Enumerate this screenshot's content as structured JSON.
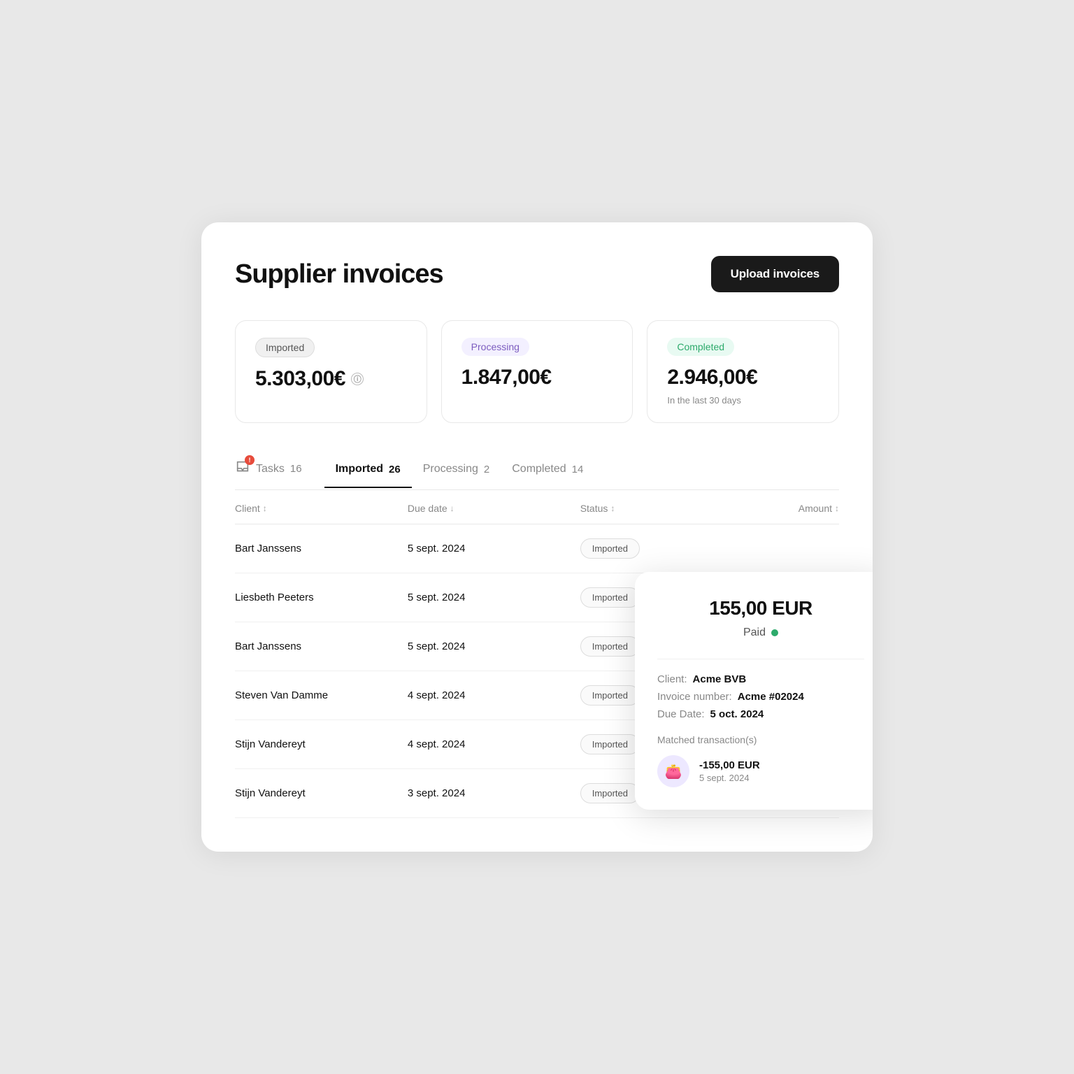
{
  "page": {
    "title": "Supplier invoices"
  },
  "header": {
    "upload_button": "Upload invoices"
  },
  "summary_cards": [
    {
      "badge": "Imported",
      "badge_type": "imported",
      "amount": "5.303,00€",
      "show_info": true,
      "subtitle": null
    },
    {
      "badge": "Processing",
      "badge_type": "processing",
      "amount": "1.847,00€",
      "show_info": false,
      "subtitle": null
    },
    {
      "badge": "Completed",
      "badge_type": "completed",
      "amount": "2.946,00€",
      "show_info": false,
      "subtitle": "In the last 30 days"
    }
  ],
  "tabs": [
    {
      "id": "tasks",
      "label": "Tasks",
      "count": "16",
      "has_badge": true,
      "active": false
    },
    {
      "id": "imported",
      "label": "Imported",
      "count": "26",
      "active": true
    },
    {
      "id": "processing",
      "label": "Processing",
      "count": "2",
      "active": false
    },
    {
      "id": "completed",
      "label": "Completed",
      "count": "14",
      "active": false
    }
  ],
  "table": {
    "columns": [
      {
        "label": "Client",
        "sort": "↕"
      },
      {
        "label": "Due date",
        "sort": "↓"
      },
      {
        "label": "Status",
        "sort": "↕"
      },
      {
        "label": "Amount",
        "sort": "↕"
      }
    ],
    "rows": [
      {
        "client": "Bart Janssens",
        "due_date": "5 sept. 2024",
        "status": "Imported",
        "amount": ""
      },
      {
        "client": "Liesbeth Peeters",
        "due_date": "5 sept. 2024",
        "status": "Imported",
        "amount": ""
      },
      {
        "client": "Bart Janssens",
        "due_date": "5 sept. 2024",
        "status": "Imported",
        "amount": ""
      },
      {
        "client": "Steven Van Damme",
        "due_date": "4 sept. 2024",
        "status": "Imported",
        "amount": ""
      },
      {
        "client": "Stijn Vandereyt",
        "due_date": "4 sept. 2024",
        "status": "Imported",
        "amount": ""
      },
      {
        "client": "Stijn Vandereyt",
        "due_date": "3 sept. 2024",
        "status": "Imported",
        "amount": ""
      }
    ]
  },
  "detail_popup": {
    "amount": "155,00 EUR",
    "status": "Paid",
    "client_label": "Client:",
    "client_value": "Acme BVB",
    "invoice_number_label": "Invoice number:",
    "invoice_number_value": "Acme #02024",
    "due_date_label": "Due Date:",
    "due_date_value": "5 oct. 2024",
    "matched_title": "Matched transaction(s)",
    "transaction_amount": "-155,00 EUR",
    "transaction_date": "5 sept. 2024"
  }
}
